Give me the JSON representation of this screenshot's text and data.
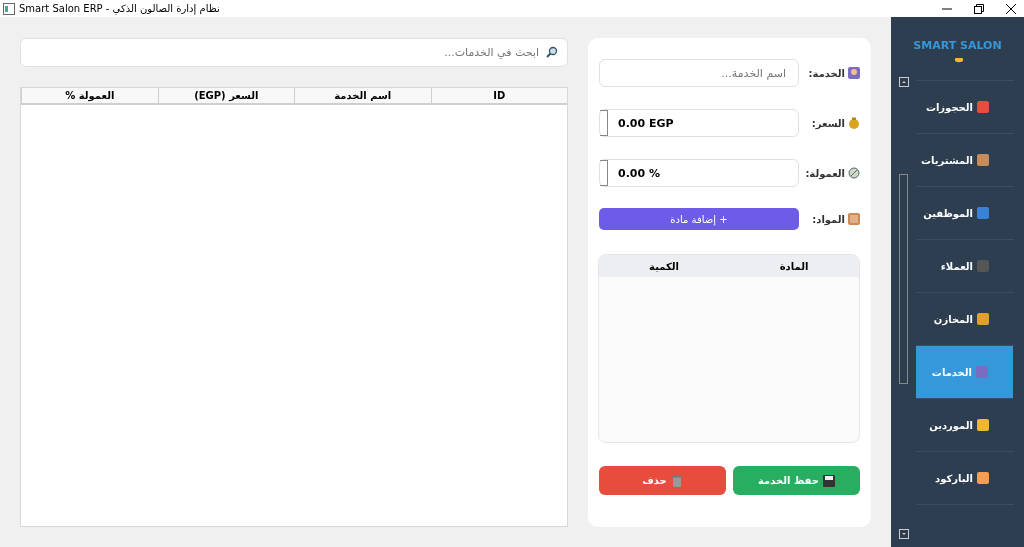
{
  "window": {
    "title": "Smart Salon ERP - نظام إدارة الصالون الذكي"
  },
  "sidebar": {
    "brand": "SMART SALON",
    "items": [
      {
        "label": "الحجوزات",
        "selected": false
      },
      {
        "label": "المشتريات",
        "selected": false
      },
      {
        "label": "الموظفين",
        "selected": false
      },
      {
        "label": "العملاء",
        "selected": false
      },
      {
        "label": "المخازن",
        "selected": false
      },
      {
        "label": "الخدمات",
        "selected": true
      },
      {
        "label": "الموردين",
        "selected": false
      },
      {
        "label": "الباركود",
        "selected": false
      }
    ]
  },
  "form": {
    "service": {
      "label": "الخدمة:",
      "placeholder": "اسم الخدمة..."
    },
    "price": {
      "label": "السعر:",
      "value": "0.00 EGP"
    },
    "commission": {
      "label": "العمولة:",
      "value": "0.00 %"
    },
    "materials": {
      "label": "المواد:",
      "add_button": "+ إضافة مادة",
      "columns": [
        "المادة",
        "الكمية"
      ]
    },
    "save_button": "حفظ الخدمة",
    "delete_button": "حذف"
  },
  "services": {
    "search": {
      "placeholder": "ابحث في الخدمات..."
    },
    "columns": [
      "ID",
      "اسم الخدمة",
      "السعر (EGP)",
      "العمولة %"
    ]
  }
}
